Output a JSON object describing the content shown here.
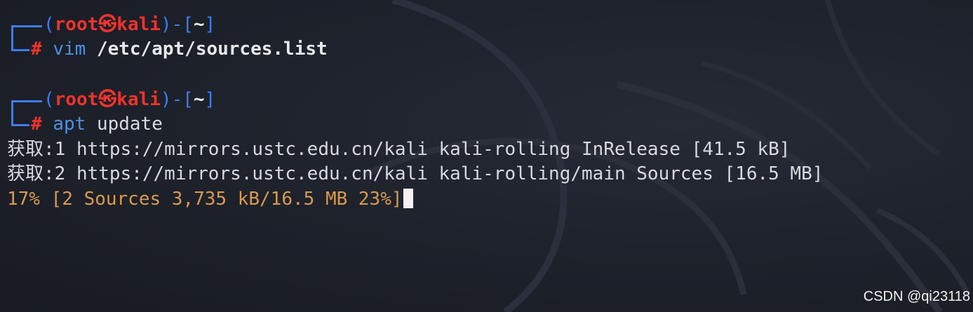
{
  "terminal": {
    "prompt1": {
      "open": "(",
      "user": "root",
      "skull": "㉿",
      "host": "kali",
      "close": ")-[",
      "dir": "~",
      "end": "]",
      "hash": "#",
      "command": "vim",
      "argument": "/etc/apt/sources.list"
    },
    "prompt2": {
      "open": "(",
      "user": "root",
      "skull": "㉿",
      "host": "kali",
      "close": ")-[",
      "dir": "~",
      "end": "]",
      "hash": "#",
      "command": "apt",
      "argument": "update"
    },
    "output": [
      "获取:1 https://mirrors.ustc.edu.cn/kali kali-rolling InRelease [41.5 kB]",
      "获取:2 https://mirrors.ustc.edu.cn/kali kali-rolling/main Sources [16.5 MB]"
    ],
    "progress_line": "17% [2 Sources 3,735 kB/16.5 MB 23%]"
  },
  "watermark": {
    "text": "CSDN @qi23118"
  },
  "colors": {
    "background": "#1d212a",
    "prompt_blue": "#3e7bf2",
    "user_red": "#f0332b",
    "progress_orange": "#d89a4e"
  }
}
